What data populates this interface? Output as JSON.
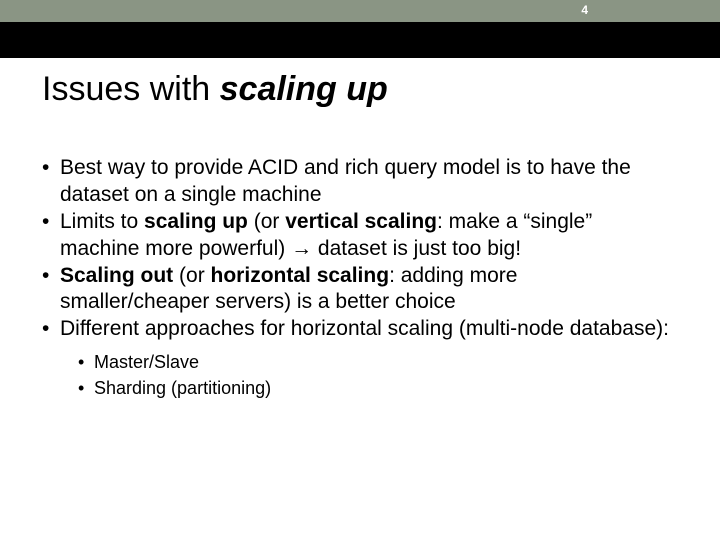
{
  "page_number": "4",
  "title": {
    "plain": "Issues with ",
    "emph": "scaling up"
  },
  "bullets": [
    {
      "segments": [
        {
          "t": "Best way to provide ACID and rich query model is to have the dataset on a single machine",
          "b": false
        }
      ]
    },
    {
      "segments": [
        {
          "t": "Limits to ",
          "b": false
        },
        {
          "t": "scaling up",
          "b": true
        },
        {
          "t": " (or ",
          "b": false
        },
        {
          "t": "vertical scaling",
          "b": true
        },
        {
          "t": ": make a “single” machine more powerful) ",
          "b": false
        },
        {
          "t": "→",
          "b": false,
          "arrow": true
        },
        {
          "t": " dataset is just too big!",
          "b": false
        }
      ]
    },
    {
      "segments": [
        {
          "t": "Scaling out",
          "b": true
        },
        {
          "t": " (or ",
          "b": false
        },
        {
          "t": "horizontal scaling",
          "b": true
        },
        {
          "t": ": adding more smaller/cheaper servers) is a better choice",
          "b": false
        }
      ]
    },
    {
      "segments": [
        {
          "t": "Different approaches for horizontal scaling (multi-node database):",
          "b": false
        }
      ],
      "children": [
        {
          "t": "Master/Slave"
        },
        {
          "t": "Sharding (partitioning)"
        }
      ]
    }
  ]
}
